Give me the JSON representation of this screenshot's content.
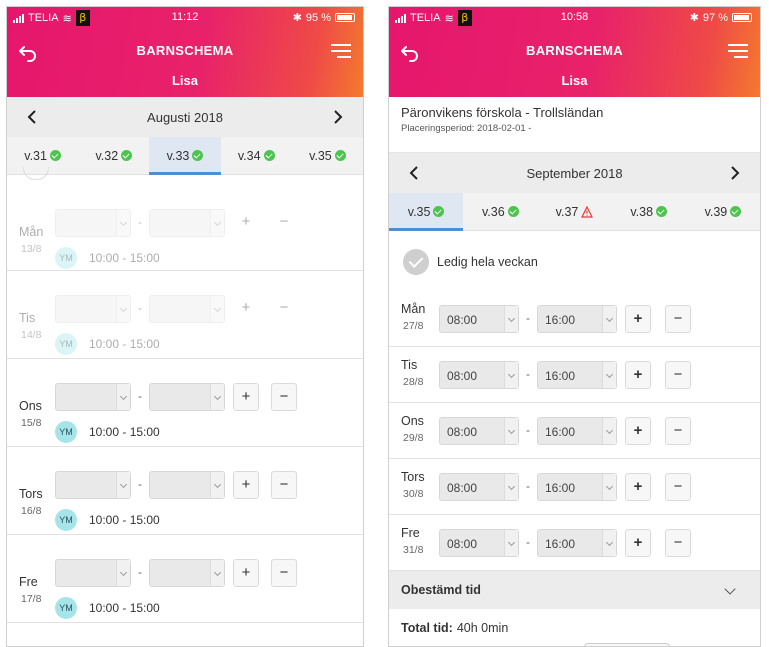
{
  "left": {
    "status": {
      "carrier": "TELIA",
      "beta": "β",
      "time": "11:12",
      "bluetooth": "✱",
      "battery": "95 %"
    },
    "header": {
      "title": "BARNSCHEMA",
      "child": "Lisa"
    },
    "month": "Augusti 2018",
    "weeks": [
      {
        "label": "v.31",
        "status": "ok",
        "active": false
      },
      {
        "label": "v.32",
        "status": "ok",
        "active": false
      },
      {
        "label": "v.33",
        "status": "ok",
        "active": true
      },
      {
        "label": "v.34",
        "status": "ok",
        "active": false
      },
      {
        "label": "v.35",
        "status": "ok",
        "active": false
      }
    ],
    "dash": "-",
    "plus": "+",
    "minus": "−",
    "days": [
      {
        "name": "Mån",
        "date": "13/8",
        "avatar": "YM",
        "time": "10:00 - 15:00"
      },
      {
        "name": "Tis",
        "date": "14/8",
        "avatar": "YM",
        "time": "10:00 - 15:00"
      },
      {
        "name": "Ons",
        "date": "15/8",
        "avatar": "YM",
        "time": "10:00 - 15:00"
      },
      {
        "name": "Tors",
        "date": "16/8",
        "avatar": "YM",
        "time": "10:00 - 15:00"
      },
      {
        "name": "Fre",
        "date": "17/8",
        "avatar": "YM",
        "time": "10:00 - 15:00"
      }
    ]
  },
  "right": {
    "status": {
      "carrier": "TELIA",
      "beta": "β",
      "time": "10:58",
      "bluetooth": "✱",
      "battery": "97 %"
    },
    "header": {
      "title": "BARNSCHEMA",
      "child": "Lisa"
    },
    "school": {
      "name": "Päronvikens förskola - Trollsländan",
      "placement": "Placeringsperiod: 2018-02-01 -"
    },
    "month": "September 2018",
    "weeks": [
      {
        "label": "v.35",
        "status": "ok",
        "active": true
      },
      {
        "label": "v.36",
        "status": "ok",
        "active": false
      },
      {
        "label": "v.37",
        "status": "warning",
        "active": false
      },
      {
        "label": "v.38",
        "status": "ok",
        "active": false
      },
      {
        "label": "v.39",
        "status": "ok",
        "active": false
      }
    ],
    "ledig_label": "Ledig hela veckan",
    "dash": "-",
    "plus": "+",
    "minus": "−",
    "days": [
      {
        "name": "Mån",
        "date": "27/8",
        "from": "08:00",
        "to": "16:00"
      },
      {
        "name": "Tis",
        "date": "28/8",
        "from": "08:00",
        "to": "16:00"
      },
      {
        "name": "Ons",
        "date": "29/8",
        "from": "08:00",
        "to": "16:00"
      },
      {
        "name": "Tors",
        "date": "30/8",
        "from": "08:00",
        "to": "16:00"
      },
      {
        "name": "Fre",
        "date": "31/8",
        "from": "08:00",
        "to": "16:00"
      }
    ],
    "obestamd": "Obestämd tid",
    "total_label": "Total tid:",
    "total_value": "40h 0min"
  }
}
